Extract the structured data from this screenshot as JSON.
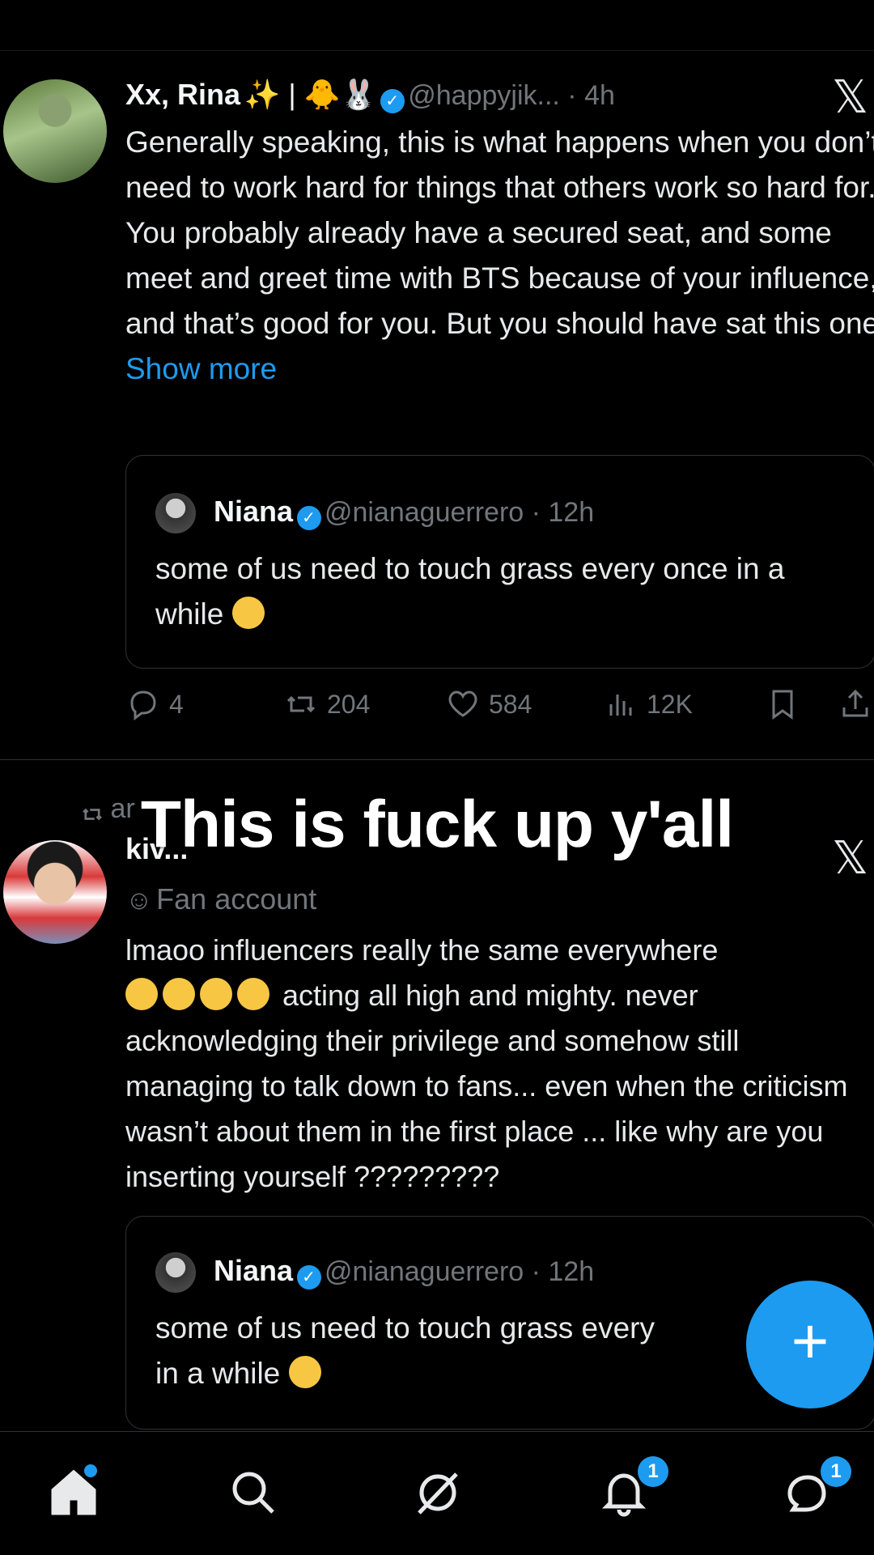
{
  "tweet1": {
    "display_name": "Xx, Rina",
    "name_decor": "✨ | 🐥🐰",
    "handle_time": "@happyjik... · 4h",
    "text": "Generally speaking, this is what happens when you don’t need to work hard for things that others work so hard for.  You probably already have a secured seat, and some meet and greet time with BTS because of your influence, and that’s good for you. But you should have sat this one",
    "show_more": "Show more",
    "quote": {
      "name": "Niana",
      "handle_time": "@nianaguerrero · 12h",
      "text": "some of us need to touch grass every once in a while"
    },
    "actions": {
      "replies": "4",
      "reposts": "204",
      "likes": "584",
      "views": "12K"
    }
  },
  "tweet2": {
    "repost_context": "ar",
    "display_name": "kiv...",
    "label": "Fan account",
    "text_line1": "lmaoo influencers really the same everywhere",
    "text_rest": "acting all high and mighty. never acknowledging their privilege and somehow still managing to talk down to fans... even when the criticism wasn’t about them in the first place ... like why are you inserting yourself ?????????",
    "quote": {
      "name": "Niana",
      "handle_time": "@nianaguerrero · 12h",
      "text_line1": "some of us need to touch grass every",
      "text_line2": "in a while"
    }
  },
  "caption": "This is fuck up y'all",
  "fab_label": "+",
  "nav": {
    "notifications_badge": "1",
    "messages_badge": "1"
  },
  "colors": {
    "accent": "#1d9bf0",
    "background": "#000000",
    "muted": "#71767b"
  },
  "icons": [
    "x-logo-icon",
    "reply-icon",
    "repost-icon",
    "like-icon",
    "views-icon",
    "bookmark-icon",
    "share-icon",
    "home-icon",
    "search-icon",
    "grok-icon",
    "notifications-icon",
    "messages-icon",
    "compose-icon"
  ]
}
